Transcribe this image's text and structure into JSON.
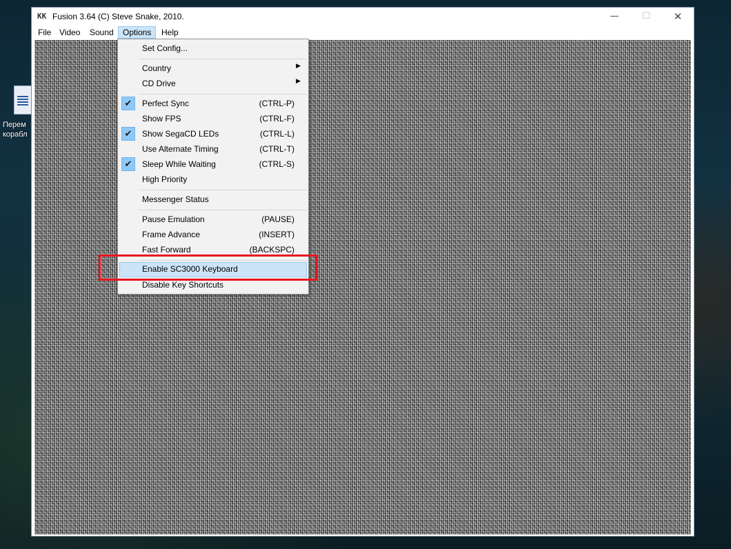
{
  "window": {
    "title": "Fusion 3.64 (C) Steve Snake, 2010."
  },
  "desktop": {
    "icon_label_1": "Перем",
    "icon_label_2": "корабл"
  },
  "menubar": [
    "File",
    "Video",
    "Sound",
    "Options",
    "Help"
  ],
  "options_menu": {
    "set_config": "Set Config...",
    "country": "Country",
    "cd_drive": "CD Drive",
    "perfect_sync": {
      "label": "Perfect Sync",
      "shortcut": "(CTRL-P)",
      "checked": true
    },
    "show_fps": {
      "label": "Show FPS",
      "shortcut": "(CTRL-F)",
      "checked": false
    },
    "show_segacd_leds": {
      "label": "Show SegaCD LEDs",
      "shortcut": "(CTRL-L)",
      "checked": true
    },
    "use_alternate_timing": {
      "label": "Use Alternate Timing",
      "shortcut": "(CTRL-T)",
      "checked": false
    },
    "sleep_while_waiting": {
      "label": "Sleep While Waiting",
      "shortcut": "(CTRL-S)",
      "checked": true
    },
    "high_priority": {
      "label": "High Priority"
    },
    "messenger_status": {
      "label": "Messenger Status"
    },
    "pause_emulation": {
      "label": "Pause Emulation",
      "shortcut": "(PAUSE)"
    },
    "frame_advance": {
      "label": "Frame Advance",
      "shortcut": "(INSERT)"
    },
    "fast_forward": {
      "label": "Fast Forward",
      "shortcut": "(BACKSPC)"
    },
    "enable_sc3000_keyboard": {
      "label": "Enable SC3000 Keyboard"
    },
    "disable_key_shortcuts": {
      "label": "Disable Key Shortcuts"
    }
  },
  "colors": {
    "highlight": "#cce4f7",
    "check_bg": "#90c8f6",
    "annotation": "#e8141e"
  },
  "icons": {
    "check": "checkmark-icon",
    "submenu": "chevron-right-icon"
  }
}
